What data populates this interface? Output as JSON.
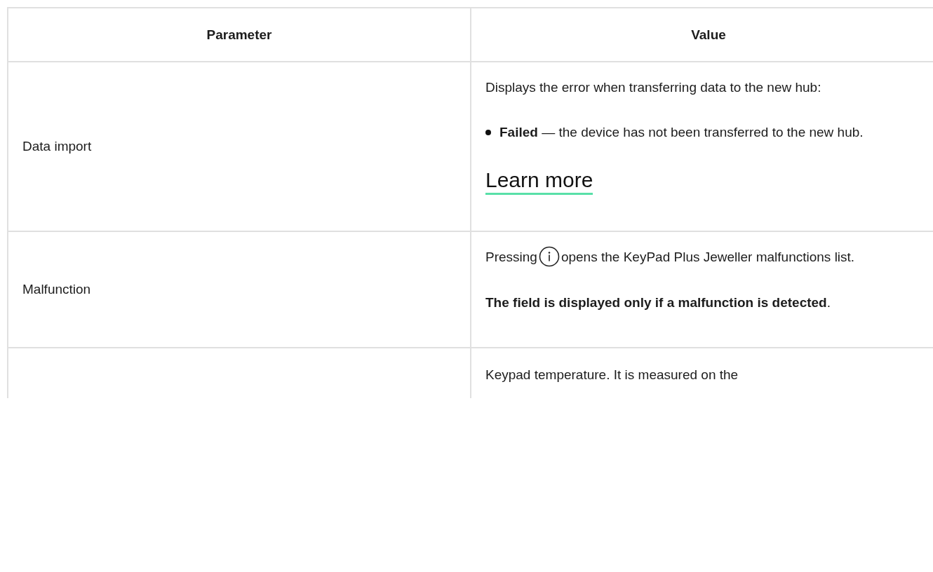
{
  "table": {
    "columns": [
      "Parameter",
      "Value"
    ],
    "rows": [
      {
        "parameter": "Data import",
        "value": [
          {
            "kind": "paragraph",
            "text": "Displays the error when transferring data to the new hub:"
          },
          {
            "kind": "bullets",
            "items": [
              "**Failed** — the device has not been transferred to the new hub."
            ]
          },
          {
            "kind": "link",
            "text": "Learn more"
          }
        ]
      },
      {
        "parameter": "Malfunction",
        "value": [
          {
            "kind": "icon_text",
            "before": "Pressing",
            "after": "opens the KeyPad Plus Jeweller malfunctions list."
          },
          {
            "kind": "paragraph",
            "text": "**The field is displayed only if a malfunction is detected**."
          }
        ]
      },
      {
        "parameter": "",
        "value": [
          {
            "kind": "paragraph",
            "text": "Keypad temperature. It is measured on the"
          }
        ]
      }
    ]
  }
}
